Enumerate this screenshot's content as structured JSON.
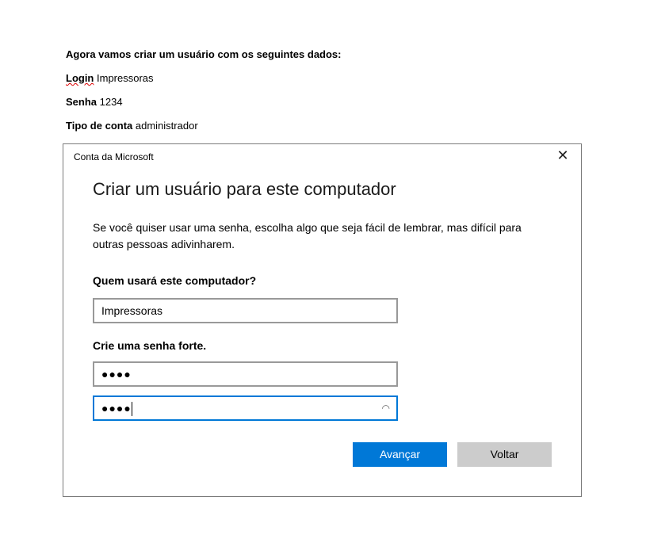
{
  "document": {
    "intro": "Agora vamos criar um usuário com os seguintes dados:",
    "login_label": "Login",
    "login_value": "Impressoras",
    "password_label": "Senha",
    "password_value": "1234",
    "account_type_label": "Tipo de conta",
    "account_type_value": "administrador"
  },
  "dialog": {
    "title": "Conta da Microsoft",
    "close": "✕",
    "heading": "Criar um usuário para este computador",
    "description": "Se você quiser usar uma senha, escolha algo que seja fácil de lembrar, mas difícil para outras pessoas adivinharem.",
    "user_label": "Quem usará este computador?",
    "user_value": "Impressoras",
    "password_label": "Crie uma senha forte.",
    "password_value": "●●●●",
    "confirm_value": "●●●●",
    "reveal_icon": "👁",
    "next_button": "Avançar",
    "back_button": "Voltar",
    "accent": "#0078d7"
  }
}
